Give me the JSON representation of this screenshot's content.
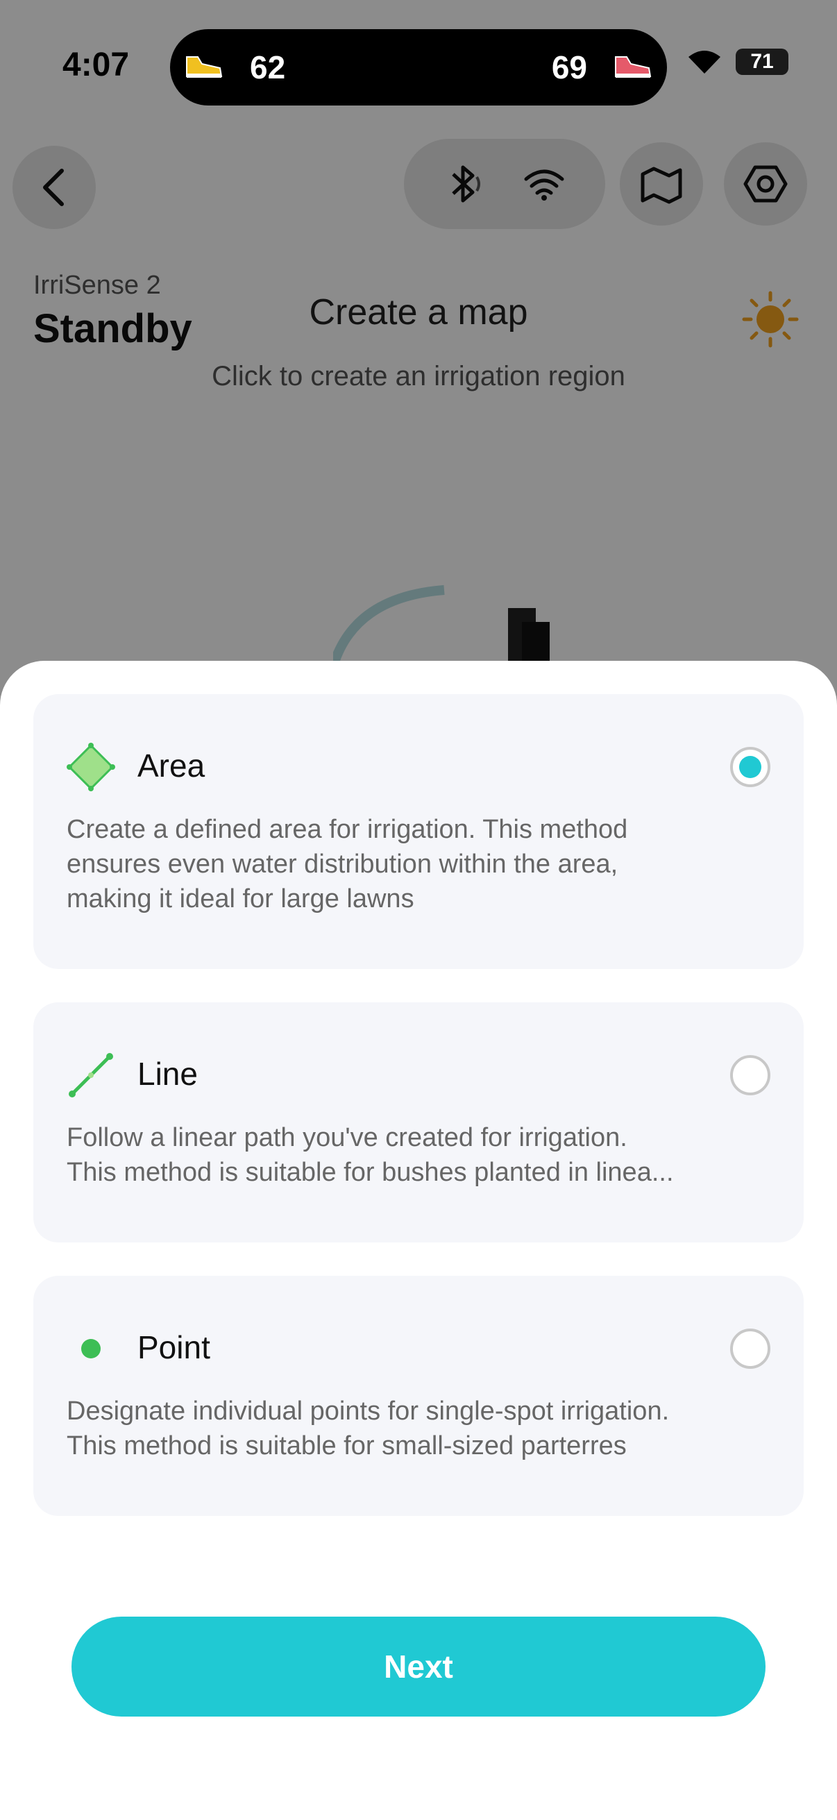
{
  "status_bar": {
    "time": "4:07",
    "left_count": "62",
    "right_count": "69",
    "battery": "71"
  },
  "header": {
    "device_name": "IrriSense 2",
    "device_state": "Standby"
  },
  "map": {
    "title": "Create a map",
    "subtitle": "Click to create an irrigation region"
  },
  "options": [
    {
      "icon": "area-icon",
      "title": "Area",
      "desc_line1": "Create a defined area for irrigation. This method",
      "desc_line2": "ensures even water distribution within the area,",
      "desc_line3": "making it ideal for large lawns",
      "selected": true
    },
    {
      "icon": "line-icon",
      "title": "Line",
      "desc_line1": "Follow a linear path you've created for irrigation.",
      "desc_line2": "This method is suitable for bushes planted in linea...",
      "selected": false
    },
    {
      "icon": "point-icon",
      "title": "Point",
      "desc_line1": "Designate individual points for single-spot irrigation.",
      "desc_line2": "This method is suitable for small-sized parterres",
      "selected": false
    }
  ],
  "next_label": "Next",
  "colors": {
    "accent": "#20c9d3",
    "green": "#3dbe55",
    "sun": "#f2a21f"
  }
}
